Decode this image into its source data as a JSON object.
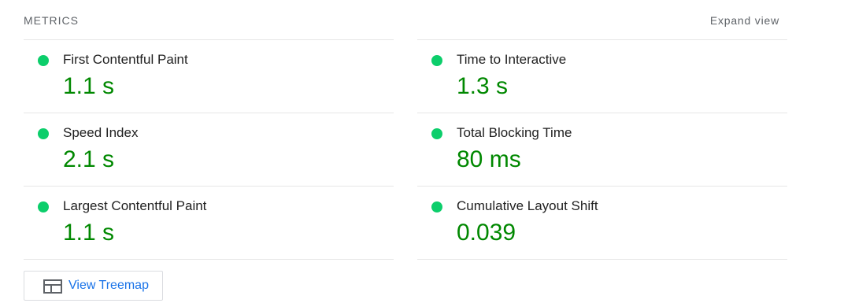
{
  "header": {
    "title": "METRICS",
    "expand_label": "Expand view"
  },
  "metrics": {
    "left": [
      {
        "label": "First Contentful Paint",
        "value": "1.1 s"
      },
      {
        "label": "Speed Index",
        "value": "2.1 s"
      },
      {
        "label": "Largest Contentful Paint",
        "value": "1.1 s"
      }
    ],
    "right": [
      {
        "label": "Time to Interactive",
        "value": "1.3 s"
      },
      {
        "label": "Total Blocking Time",
        "value": "80 ms"
      },
      {
        "label": "Cumulative Layout Shift",
        "value": "0.039"
      }
    ]
  },
  "status_color": "#0cce6b",
  "value_color": "#008800",
  "treemap": {
    "label": "View Treemap",
    "icon": "treemap-icon"
  }
}
